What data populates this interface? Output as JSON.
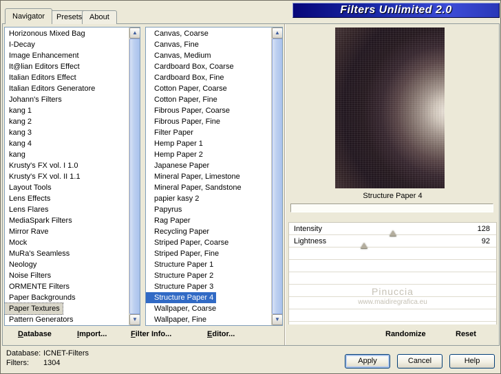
{
  "window": {
    "title": "Filters Unlimited 2.0"
  },
  "tabs": [
    {
      "label": "Navigator",
      "active": true
    },
    {
      "label": "Presets",
      "active": false
    },
    {
      "label": "About",
      "active": false
    }
  ],
  "left_list": {
    "selected_index": 25,
    "items": [
      "Horizonous Mixed Bag",
      "I-Decay",
      "Image Enhancement",
      "It@lian Editors Effect",
      "Italian Editors Effect",
      "Italian Editors Generatore",
      "Johann's Filters",
      "kang 1",
      "kang 2",
      "kang 3",
      "kang 4",
      "kang",
      "Krusty's FX vol. I 1.0",
      "Krusty's FX vol. II 1.1",
      "Layout Tools",
      "Lens Effects",
      "Lens Flares",
      "MediaSpark Filters",
      "Mirror Rave",
      "Mock",
      "MuRa's Seamless",
      "Neology",
      "Noise Filters",
      "ORMENTE Filters",
      "Paper Backgrounds",
      "Paper Textures",
      "Pattern Generators"
    ]
  },
  "middle_list": {
    "selected_index": 24,
    "items": [
      "Canvas, Coarse",
      "Canvas, Fine",
      "Canvas, Medium",
      "Cardboard Box, Coarse",
      "Cardboard Box, Fine",
      "Cotton Paper, Coarse",
      "Cotton Paper, Fine",
      "Fibrous Paper, Coarse",
      "Fibrous Paper, Fine",
      "Filter Paper",
      "Hemp Paper 1",
      "Hemp Paper 2",
      "Japanese Paper",
      "Mineral Paper, Limestone",
      "Mineral Paper, Sandstone",
      "papier kasy 2",
      "Papyrus",
      "Rag Paper",
      "Recycling Paper",
      "Striped Paper, Coarse",
      "Striped Paper, Fine",
      "Structure Paper 1",
      "Structure Paper 2",
      "Structure Paper 3",
      "Structure Paper 4",
      "Wallpaper, Coarse",
      "Wallpaper, Fine"
    ]
  },
  "preview": {
    "caption": "Structure Paper 4"
  },
  "controls": [
    {
      "name": "Intensity",
      "value": 128,
      "max": 255
    },
    {
      "name": "Lightness",
      "value": 92,
      "max": 255
    }
  ],
  "watermark": {
    "line1": "Pinuccia",
    "line2": "www.maidiregrafica.eu"
  },
  "toolbar": {
    "database": "Database",
    "import": "Import...",
    "filter_info": "Filter Info...",
    "editor": "Editor...",
    "randomize": "Randomize",
    "reset": "Reset"
  },
  "status": {
    "database_label": "Database:",
    "database_value": "ICNET-Filters",
    "filters_label": "Filters:",
    "filters_value": "1304"
  },
  "buttons": {
    "apply": "Apply",
    "cancel": "Cancel",
    "help": "Help"
  },
  "icons": {
    "scroll_up": "▲",
    "scroll_down": "▼"
  },
  "colors": {
    "selection": "#316ac5",
    "banner_start": "#07077a",
    "banner_end": "#3c4cd8",
    "dialog": "#ece9d8"
  }
}
